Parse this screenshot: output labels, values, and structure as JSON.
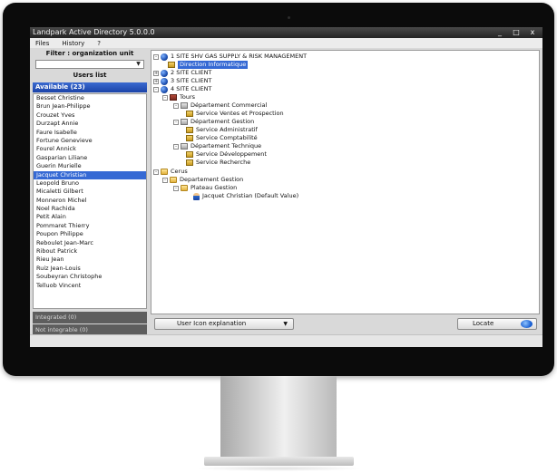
{
  "window": {
    "title": "Landpark Active Directory 5.0.0.0",
    "controls": [
      "_",
      "□",
      "x"
    ]
  },
  "menu": [
    "Files",
    "History",
    "?"
  ],
  "left": {
    "filter_label": "Filter : organization unit",
    "users_list_label": "Users list",
    "available_header": "Available (23)",
    "users": [
      "Besset Christine",
      "Brun Jean-Philippe",
      "Crouzet Yves",
      "Durzapt Annie",
      "Faure Isabelle",
      "Fortune Genevieve",
      "Fourel Annick",
      "Gasparian Liliane",
      "Guerin Murielle",
      "Jacquet Christian",
      "Leopold Bruno",
      "Micaletti Gilbert",
      "Monneron Michel",
      "Noel Rachida",
      "Petit Alain",
      "Pommaret Thierry",
      "Poupon Philippe",
      "Reboulet Jean-Marc",
      "Ribout Patrick",
      "Rieu Jean",
      "Ruiz Jean-Louis",
      "Soubeyran Christophe",
      "Telluob Vincent"
    ],
    "selected_index": 9,
    "integrated_label": "Integrated (0)",
    "not_integrable_label": "Not integrable (0)"
  },
  "tree": [
    {
      "label": "1 SITE SHV GAS SUPPLY & RISK MANAGEMENT",
      "icon": "globe-icon",
      "expander": "-"
    },
    {
      "label": "Direction Informatique",
      "icon": "orgunit-icon",
      "highlighted": true
    },
    {
      "label": "2 SITE CLIENT",
      "icon": "globe-icon",
      "expander": "+"
    },
    {
      "label": "3 SITE CLIENT",
      "icon": "globe-icon",
      "expander": "+"
    },
    {
      "label": "4 SITE CLIENT",
      "icon": "globe-icon",
      "expander": "-"
    },
    {
      "label": "Tours",
      "icon": "building-icon",
      "expander": "-"
    },
    {
      "label": "Département Commercial",
      "icon": "dept-icon",
      "expander": "-"
    },
    {
      "label": "Service Ventes et Prospection",
      "icon": "orgunit-icon"
    },
    {
      "label": "Département Gestion",
      "icon": "dept-icon",
      "expander": "-"
    },
    {
      "label": "Service Administratif",
      "icon": "orgunit-icon"
    },
    {
      "label": "Service Comptabilité",
      "icon": "orgunit-icon"
    },
    {
      "label": "Département Technique",
      "icon": "dept-icon",
      "expander": "-"
    },
    {
      "label": "Service Développement",
      "icon": "orgunit-icon"
    },
    {
      "label": "Service Recherche",
      "icon": "orgunit-icon"
    },
    {
      "label": "Cerus",
      "icon": "folder-icon",
      "expander": "-"
    },
    {
      "label": "Departement Gestion",
      "icon": "folder-icon",
      "expander": "-"
    },
    {
      "label": "Plateau Gestion",
      "icon": "folder-icon",
      "expander": "-"
    },
    {
      "label": "Jacquet Christian (Default Value)",
      "icon": "user-icon"
    }
  ],
  "bottom": {
    "user_icon_explanation": "User Icon explanation",
    "locate": "Locate"
  }
}
